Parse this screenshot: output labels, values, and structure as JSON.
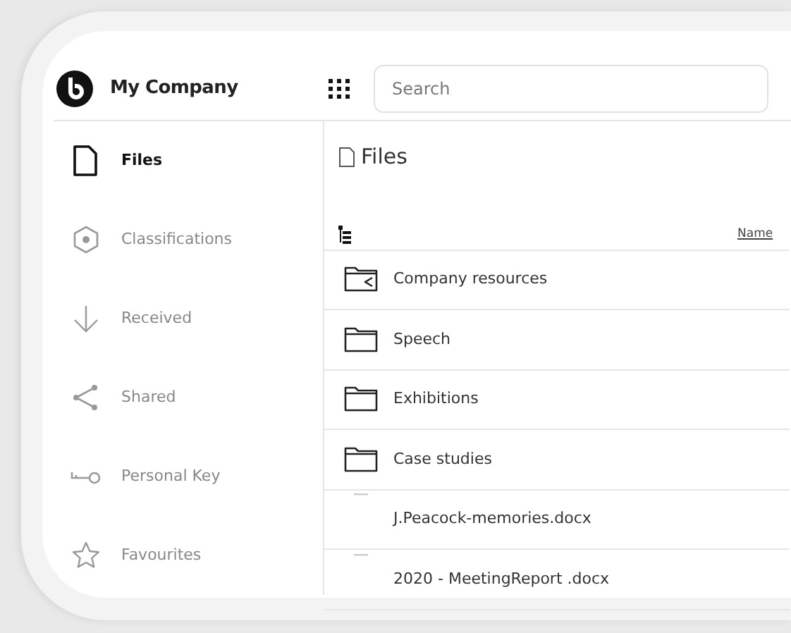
{
  "brand": {
    "name": "My Company"
  },
  "search": {
    "placeholder": "Search"
  },
  "sidebar": {
    "items": [
      {
        "label": "Files",
        "kind": "file",
        "selected": true
      },
      {
        "label": "Classifications",
        "kind": "hexagon",
        "selected": false
      },
      {
        "label": "Received",
        "kind": "arrow",
        "selected": false
      },
      {
        "label": "Shared",
        "kind": "share",
        "selected": false
      },
      {
        "label": "Personal Key",
        "kind": "key",
        "selected": false
      },
      {
        "label": "Favourites",
        "kind": "star",
        "selected": false
      }
    ]
  },
  "page_title": "Files",
  "table": {
    "columns": [
      "Name"
    ],
    "rows": [
      {
        "kind": "shared-folder",
        "name": "Company resources"
      },
      {
        "kind": "folder",
        "name": "Speech"
      },
      {
        "kind": "folder",
        "name": "Exhibitions"
      },
      {
        "kind": "folder",
        "name": "Case studies"
      },
      {
        "kind": "document",
        "name": "J.Peacock-memories.docx"
      },
      {
        "kind": "document",
        "name": "2020 - MeetingReport .docx"
      }
    ]
  }
}
